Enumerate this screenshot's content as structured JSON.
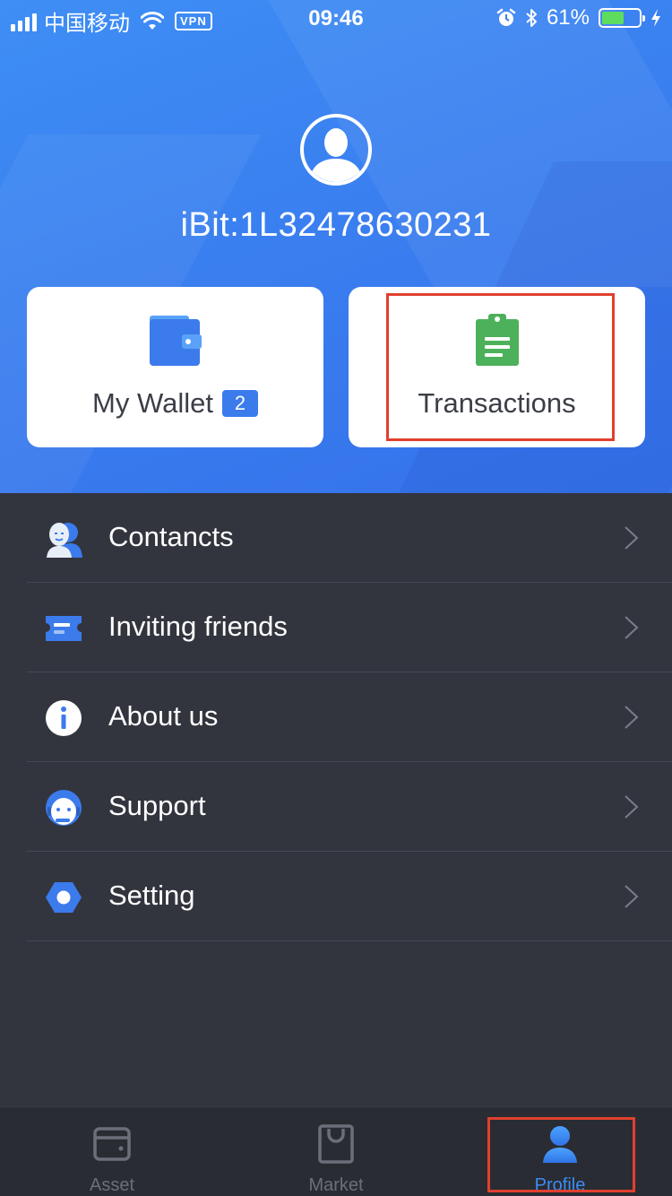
{
  "status_bar": {
    "carrier": "中国移动",
    "vpn": "VPN",
    "time": "09:46",
    "battery": "61%",
    "battery_level": 0.61,
    "battery_color": "#5ddc5e"
  },
  "header": {
    "user_id": "iBit:1L32478630231",
    "background_color": "#3a7ff0"
  },
  "cards": {
    "wallet": {
      "label": "My Wallet",
      "count": "2",
      "icon": "wallet-icon"
    },
    "transactions": {
      "label": "Transactions",
      "icon": "clipboard-icon",
      "highlighted": true
    }
  },
  "menu": {
    "items": [
      {
        "label": "Contancts",
        "icon": "contacts-icon"
      },
      {
        "label": "Inviting friends",
        "icon": "ticket-icon"
      },
      {
        "label": "About us",
        "icon": "info-icon"
      },
      {
        "label": "Support",
        "icon": "headset-icon"
      },
      {
        "label": "Setting",
        "icon": "settings-hexagon-icon"
      }
    ]
  },
  "tab_bar": {
    "tabs": [
      {
        "label": "Asset",
        "icon": "wallet-outline-icon",
        "active": false
      },
      {
        "label": "Market",
        "icon": "shopping-bag-icon",
        "active": false
      },
      {
        "label": "Profile",
        "icon": "user-icon",
        "active": true,
        "highlighted": true
      }
    ]
  },
  "colors": {
    "accent": "#3b7bec",
    "highlight_border": "#e0402e",
    "menu_background": "#32353e",
    "tabbar_background": "#2a2c33"
  }
}
